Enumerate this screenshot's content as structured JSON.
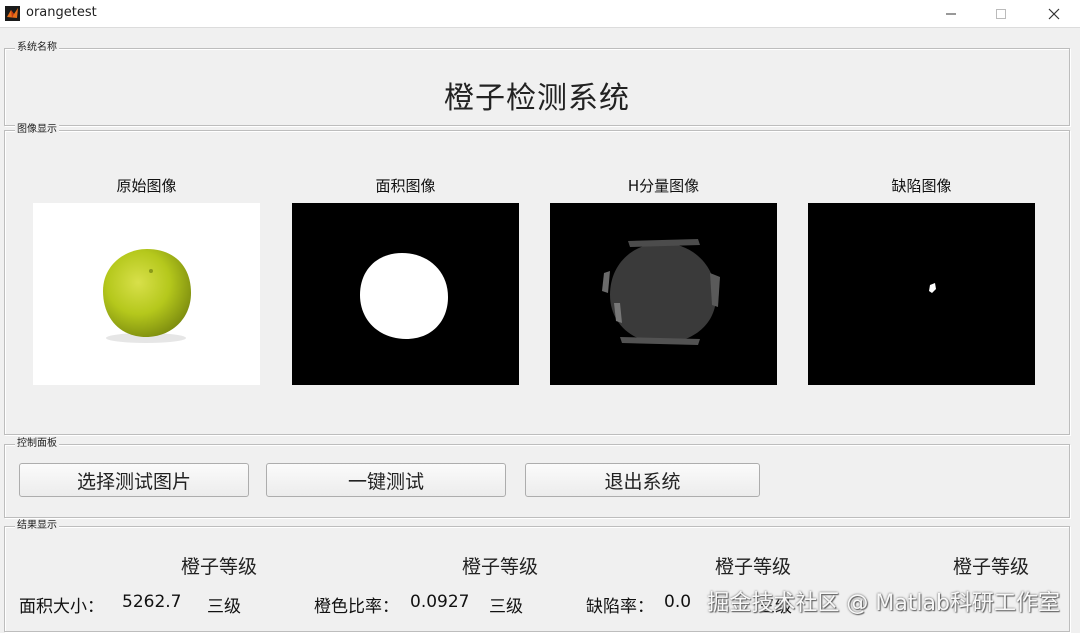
{
  "window": {
    "title": "orangetest",
    "icon": "matlab-icon"
  },
  "panels": {
    "system_name": "系统名称",
    "image_display": "图像显示",
    "control": "控制面板",
    "results": "结果显示"
  },
  "system_title": "橙子检测系统",
  "images": [
    {
      "caption": "原始图像",
      "kind": "original"
    },
    {
      "caption": "面积图像",
      "kind": "area"
    },
    {
      "caption": "H分量图像",
      "kind": "hue"
    },
    {
      "caption": "缺陷图像",
      "kind": "defect"
    }
  ],
  "buttons": {
    "select": "选择测试图片",
    "run": "一键测试",
    "exit": "退出系统"
  },
  "results": {
    "grade_headers": [
      "橙子等级",
      "橙子等级",
      "橙子等级",
      "橙子等级"
    ],
    "area_label": "面积大小：",
    "area_value": "5262.7",
    "area_grade": "三级",
    "color_label": "橙色比率：",
    "color_value": "0.0927",
    "color_grade": "三级",
    "defect_label": "缺陷率：",
    "defect_value": "0.0",
    "defect_grade": "三级"
  },
  "watermark": "掘金技术社区 @ Matlab科研工作室",
  "colors": {
    "background": "#f0f0f0",
    "orange_fill": "#b5c81c",
    "image_black": "#000000"
  }
}
